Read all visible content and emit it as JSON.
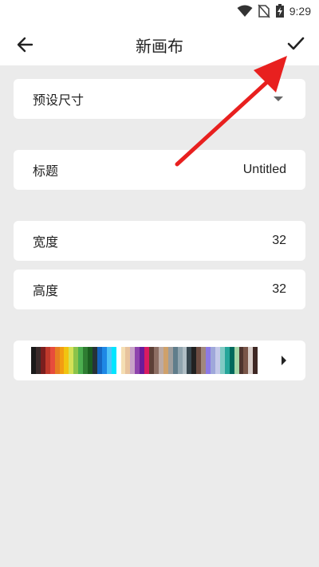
{
  "status_bar": {
    "time": "9:29",
    "icons": [
      "wifi-icon",
      "no-sim-icon",
      "battery-charging-icon"
    ]
  },
  "app_bar": {
    "title": "新画布",
    "back_icon": "arrow-back-icon",
    "confirm_icon": "check-icon"
  },
  "form": {
    "preset": {
      "label": "预设尺寸"
    },
    "title": {
      "label": "标题",
      "value": "Untitled"
    },
    "width": {
      "label": "宽度",
      "value": "32"
    },
    "height": {
      "label": "高度",
      "value": "32"
    },
    "palette": {
      "colors": [
        "#1a1a1a",
        "#3a2a2a",
        "#7a1e1e",
        "#c0392b",
        "#e74c3c",
        "#e67e22",
        "#f39c12",
        "#f1c40f",
        "#d4e157",
        "#8bc34a",
        "#4caf50",
        "#2e7d32",
        "#1b5e20",
        "#263238",
        "#1565c0",
        "#1e88e5",
        "#4fc3f7",
        "#00e5ff",
        "#ffffff",
        "#f5deb3",
        "#e8c39e",
        "#c8a2c8",
        "#8e44ad",
        "#6a1b9a",
        "#d81b60",
        "#5d4037",
        "#8d6e63",
        "#bcaaa4",
        "#cfa16a",
        "#9e9e9e",
        "#607d8b",
        "#90a4ae",
        "#b0bec5",
        "#37474f",
        "#212121",
        "#6d4c41",
        "#a1887f",
        "#8c7ae6",
        "#9fa8da",
        "#c5cae9",
        "#80cbc4",
        "#26a69a",
        "#00695c",
        "#a5d6a7",
        "#4e342e",
        "#795548",
        "#d7ccc8",
        "#3e2723"
      ]
    }
  },
  "colors": {
    "annotation_arrow": "#e8201f",
    "background": "#ebebeb",
    "card": "#ffffff"
  }
}
